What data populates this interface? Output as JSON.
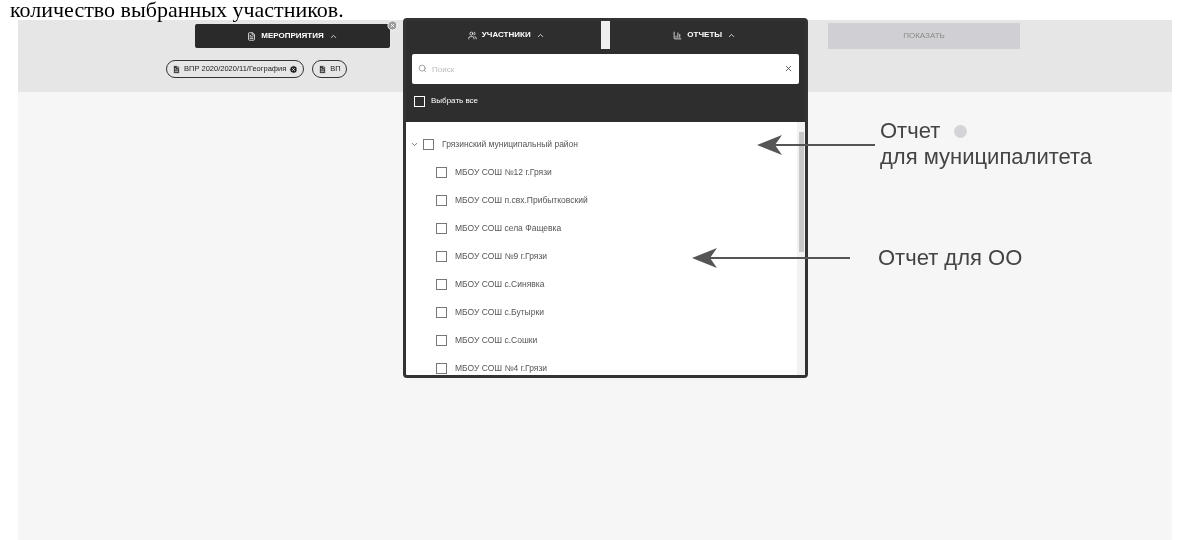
{
  "caption": "количество выбранных участников.",
  "toolbar": {
    "events_button": {
      "label": "МЕРОПРИЯТИЯ",
      "expanded": true
    },
    "participants_button": {
      "label": "УЧАСТНИКИ",
      "expanded": true
    },
    "reports_button": {
      "label": "ОТЧЕТЫ",
      "expanded": true
    },
    "show_button": {
      "label": "ПОКАЗАТЬ",
      "disabled": true
    }
  },
  "chips": [
    {
      "label": "ВПР 2020/2020/11/География"
    },
    {
      "label": "ВП"
    }
  ],
  "dropdown": {
    "search": {
      "placeholder": "Поиск"
    },
    "select_all": {
      "label": "Выбрать все",
      "checked": false
    },
    "tree": [
      {
        "label": "Грязинский муниципальный район",
        "checked": false,
        "expanded": true,
        "children": [
          {
            "label": "МБОУ СОШ №12 г.Грязи",
            "checked": false
          },
          {
            "label": "МБОУ СОШ п.свх.Прибытковский",
            "checked": false
          },
          {
            "label": "МБОУ СОШ села Фащевка",
            "checked": false
          },
          {
            "label": "МБОУ СОШ №9 г.Грязи",
            "checked": false
          },
          {
            "label": "МБОУ СОШ с.Синявка",
            "checked": false
          },
          {
            "label": "МБОУ СОШ с.Бутырки",
            "checked": false
          },
          {
            "label": "МБОУ СОШ с.Сошки",
            "checked": false
          },
          {
            "label": "МБОУ СОШ №4 г.Грязи",
            "checked": false
          }
        ]
      }
    ]
  },
  "annotations": [
    {
      "lines": [
        "Отчет",
        "для муниципалитета"
      ]
    },
    {
      "lines": [
        "Отчет для ОО"
      ]
    }
  ]
}
